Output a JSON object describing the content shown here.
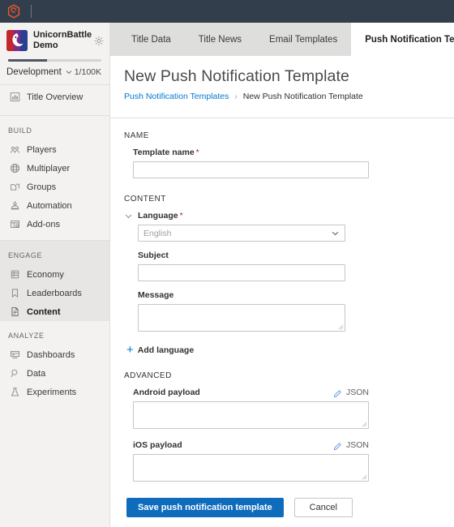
{
  "topbar": {
    "logo_icon": "playfab-logo-icon"
  },
  "sidebar": {
    "studio_title": "UnicornBattle Demo",
    "gear_icon": "gear-icon",
    "environment": "Development",
    "environment_chevron_icon": "chevron-down-icon",
    "quota": "1/100K",
    "overview": {
      "label": "Title Overview",
      "icon": "chart-bar-icon"
    },
    "groups": [
      {
        "label": "BUILD",
        "items": [
          {
            "label": "Players",
            "icon": "players-icon"
          },
          {
            "label": "Multiplayer",
            "icon": "globe-icon"
          },
          {
            "label": "Groups",
            "icon": "folder-icon"
          },
          {
            "label": "Automation",
            "icon": "robot-icon"
          },
          {
            "label": "Add-ons",
            "icon": "addons-grid-icon"
          }
        ]
      },
      {
        "label": "ENGAGE",
        "items": [
          {
            "label": "Economy",
            "icon": "economy-icon"
          },
          {
            "label": "Leaderboards",
            "icon": "bookmark-icon"
          },
          {
            "label": "Content",
            "icon": "document-icon"
          }
        ]
      },
      {
        "label": "ANALYZE",
        "items": [
          {
            "label": "Dashboards",
            "icon": "dashboard-icon"
          },
          {
            "label": "Data",
            "icon": "magnifier-icon"
          },
          {
            "label": "Experiments",
            "icon": "flask-icon"
          }
        ]
      }
    ],
    "active_item": "Content"
  },
  "tabs": [
    {
      "label": "Title Data",
      "active": false
    },
    {
      "label": "Title News",
      "active": false
    },
    {
      "label": "Email Templates",
      "active": false
    },
    {
      "label": "Push Notification Templates",
      "active": true
    }
  ],
  "page": {
    "title": "New Push Notification Template",
    "breadcrumb": {
      "link": "Push Notification Templates",
      "separator": "›",
      "current": "New Push Notification Template"
    }
  },
  "form": {
    "name_section": {
      "heading": "NAME",
      "template_name_label": "Template name",
      "required_mark": "*",
      "template_name_value": "",
      "template_name_placeholder": ""
    },
    "content_section": {
      "heading": "CONTENT",
      "collapse_icon": "chevron-down-icon",
      "language_label": "Language",
      "language_required_mark": "*",
      "language_value": "English",
      "language_chevron_icon": "chevron-down-icon",
      "subject_label": "Subject",
      "subject_value": "",
      "message_label": "Message",
      "message_value": "",
      "add_language_label": "Add language",
      "add_language_icon": "plus-icon"
    },
    "advanced_section": {
      "heading": "ADVANCED",
      "android_label": "Android payload",
      "android_value": "",
      "android_json_label": "JSON",
      "android_json_icon": "pencil-icon",
      "ios_label": "iOS payload",
      "ios_value": "",
      "ios_json_label": "JSON",
      "ios_json_icon": "pencil-icon"
    },
    "actions": {
      "save_label": "Save push notification template",
      "cancel_label": "Cancel"
    }
  },
  "colors": {
    "topbar_bg": "#333e4d",
    "accent_blue": "#0078d4",
    "primary_button": "#0f6cbd",
    "required_red": "#a4262c",
    "sidebar_bg": "#f3f2f1",
    "sidebar_active_group_bg": "#e8e6e4",
    "tabstrip_bg": "#dededd"
  }
}
